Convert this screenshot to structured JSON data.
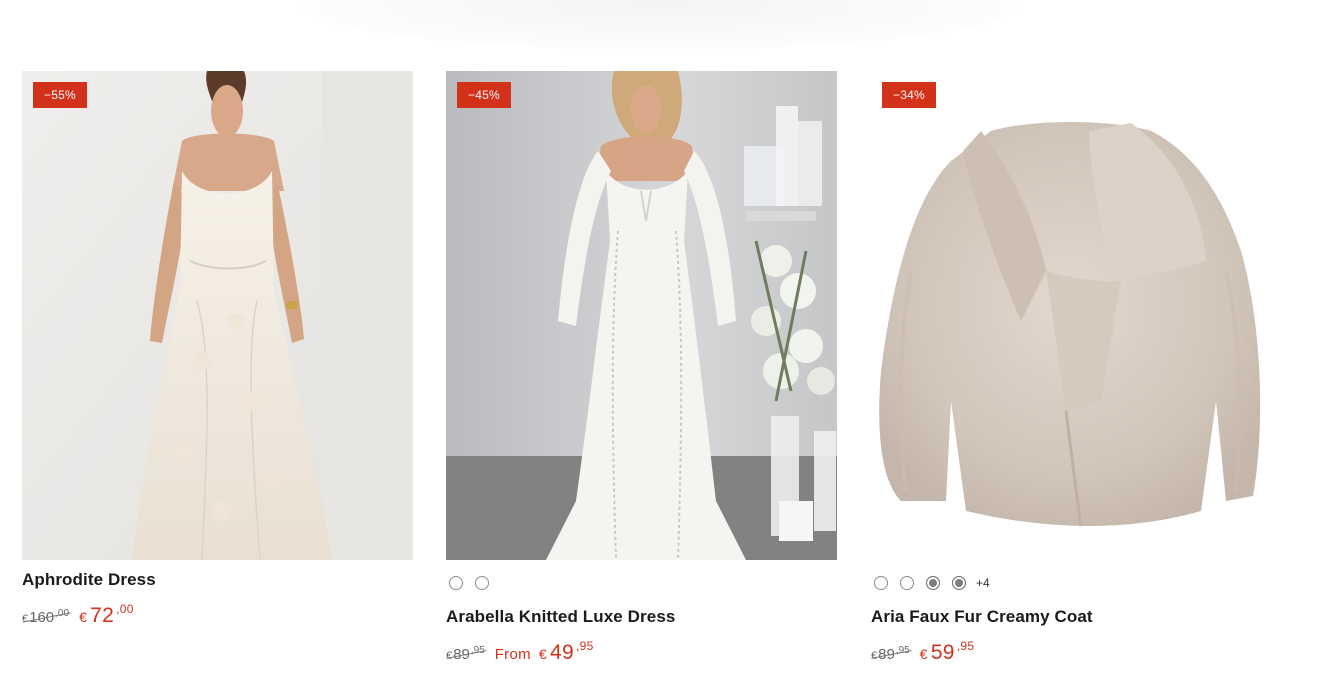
{
  "products": [
    {
      "title": "Aphrodite Dress",
      "discount": "−55%",
      "image": "white-floral-maxi-dress",
      "old_price": {
        "currency": "€",
        "whole": "160",
        "cents": ",00"
      },
      "new_price": {
        "currency": "€",
        "whole": "72",
        "cents": ",00"
      },
      "colors": []
    },
    {
      "title": "Arabella Knitted Luxe Dress",
      "discount": "−45%",
      "image": "white-knit-off-shoulder-gown",
      "colors": [
        "white",
        "white"
      ],
      "old_price": {
        "currency": "€",
        "whole": "89",
        "cents": ",95"
      },
      "price_prefix": "From",
      "new_price": {
        "currency": "€",
        "whole": "49",
        "cents": ",95"
      }
    },
    {
      "title": "Aria Faux Fur Creamy Coat",
      "discount": "−34%",
      "image": "beige-faux-fur-coat",
      "colors": [
        "white",
        "white",
        "grey",
        "grey"
      ],
      "more_colors": "+4",
      "old_price": {
        "currency": "€",
        "whole": "89",
        "cents": ",95"
      },
      "new_price": {
        "currency": "€",
        "whole": "59",
        "cents": ",95"
      }
    }
  ],
  "colors": {
    "sale_red": "#d2311a",
    "text": "#1b1b1b",
    "muted": "#666666"
  }
}
